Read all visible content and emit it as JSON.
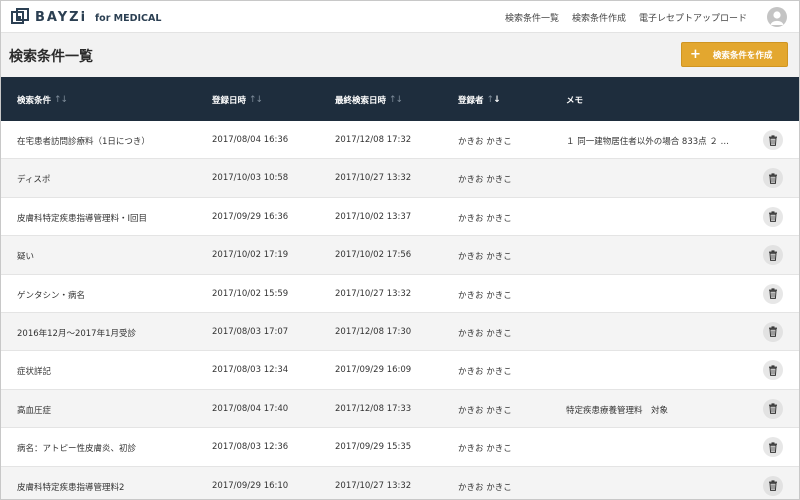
{
  "header": {
    "logo_text": "BAYZi",
    "logo_sub": "for MEDICAL",
    "nav": [
      "検索条件一覧",
      "検索条件作成",
      "電子レセプトアップロード"
    ]
  },
  "page": {
    "title": "検索条件一覧",
    "create_button": "検索条件を作成"
  },
  "table": {
    "columns": [
      "検索条件",
      "登録日時",
      "最終検索日時",
      "登録者",
      "メモ"
    ],
    "rows": [
      {
        "name": "在宅患者訪問診療料（1日につき）",
        "registered": "2017/08/04 16:36",
        "last_search": "2017/12/08 17:32",
        "user": "かきお かきこ",
        "memo": "１ 同一建物居住者以外の場合 833点 ２ …"
      },
      {
        "name": "ディスポ",
        "registered": "2017/10/03 10:58",
        "last_search": "2017/10/27 13:32",
        "user": "かきお かきこ",
        "memo": ""
      },
      {
        "name": "皮膚科特定疾患指導管理料・I回目",
        "registered": "2017/09/29 16:36",
        "last_search": "2017/10/02 13:37",
        "user": "かきお かきこ",
        "memo": ""
      },
      {
        "name": "疑い",
        "registered": "2017/10/02 17:19",
        "last_search": "2017/10/02 17:56",
        "user": "かきお かきこ",
        "memo": ""
      },
      {
        "name": "ゲンタシン・病名",
        "registered": "2017/10/02 15:59",
        "last_search": "2017/10/27 13:32",
        "user": "かきお かきこ",
        "memo": ""
      },
      {
        "name": "2016年12月～2017年1月受診",
        "registered": "2017/08/03 17:07",
        "last_search": "2017/12/08 17:30",
        "user": "かきお かきこ",
        "memo": ""
      },
      {
        "name": "症状詳記",
        "registered": "2017/08/03 12:34",
        "last_search": "2017/09/29 16:09",
        "user": "かきお かきこ",
        "memo": ""
      },
      {
        "name": "高血圧症",
        "registered": "2017/08/04 17:40",
        "last_search": "2017/12/08 17:33",
        "user": "かきお かきこ",
        "memo": "特定疾患療養管理料　対象"
      },
      {
        "name": "病名：アトピー性皮膚炎、初診",
        "registered": "2017/08/03 12:36",
        "last_search": "2017/09/29 15:35",
        "user": "かきお かきこ",
        "memo": ""
      },
      {
        "name": "皮膚科特定疾患指導管理料2",
        "registered": "2017/09/29 16:10",
        "last_search": "2017/10/27 13:32",
        "user": "かきお かきこ",
        "memo": ""
      }
    ]
  },
  "icons": {
    "logo": "bayzi-logo-icon",
    "avatar": "user-avatar-icon",
    "delete": "trash-icon",
    "sort": "sort-arrows-icon",
    "add": "plus-icon"
  },
  "colors": {
    "header_bg": "#1e2d3d",
    "accent": "#e3a72f",
    "logo": "#2b3f52"
  }
}
